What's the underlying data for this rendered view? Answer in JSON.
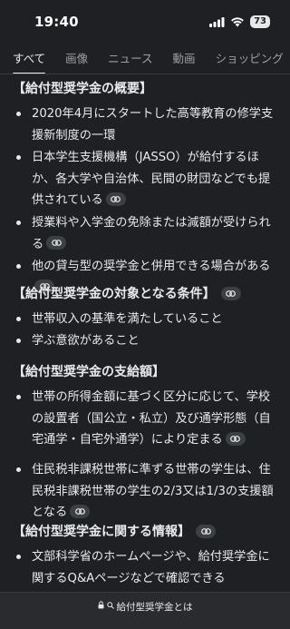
{
  "status_bar": {
    "time": "19:40",
    "battery": "73"
  },
  "tabs": [
    {
      "label": "すべて",
      "active": true
    },
    {
      "label": "画像"
    },
    {
      "label": "ニュース"
    },
    {
      "label": "動画"
    },
    {
      "label": "ショッピング"
    },
    {
      "label": "ショ"
    }
  ],
  "sections": [
    {
      "heading": "【給付型奨学金の概要】",
      "bullets": [
        "2020年4月にスタートした高等教育の修学支援新制度の一環",
        "日本学生支援機構（JASSO）が給付するほか、各大学や自治体、民間の財団などでも提供されている",
        "授業料や入学金の免除または減額が受けられる",
        "他の貸与型の奨学金と併用できる場合がある"
      ]
    },
    {
      "heading": "【給付型奨学金の対象となる条件】",
      "bullets": [
        "世帯収入の基準を満たしていること",
        "学ぶ意欲があること"
      ]
    },
    {
      "heading": "【給付型奨学金の支給額】",
      "bullets": [
        "世帯の所得金額に基づく区分に応じて、学校の設置者（国公立・私立）及び通学形態（自宅通学・自宅外通学）により定まる",
        "住民税非課税世帯に準ずる世帯の学生は、住民税非課税世帯の学生の2/3又は1/3の支援額となる"
      ]
    },
    {
      "heading": "【給付型奨学金に関する情報】",
      "bullets": [
        "文部科学省のホームページや、給付奨学金に関するQ&Aページなどで確認できる"
      ]
    }
  ],
  "bottom_bar": {
    "url": "給付型奨学金とは"
  }
}
